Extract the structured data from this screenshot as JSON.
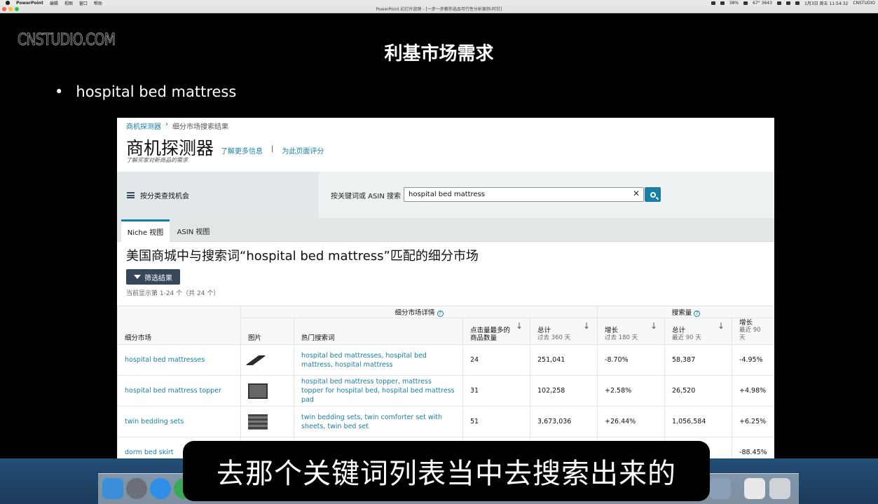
{
  "menubar": {
    "app": "PowerPoint",
    "items": [
      "编辑",
      "视图",
      "窗口",
      "帮助"
    ],
    "status": [
      "38%",
      "67° 3643",
      "1月3日 周五 11:54:32",
      "CNSTUDIO"
    ]
  },
  "window_title": "PowerPoint 幻灯片放映 - [一步一步教你选品可行性分析案例-阿甘]",
  "watermark": "CNSTUDIO.COM",
  "slide": {
    "title": "利基市场需求",
    "bullet_mark": "•",
    "bullet": "hospital bed mattress"
  },
  "tool": {
    "breadcrumb": {
      "root": "商机探测器",
      "sep": "›",
      "current": "细分市场搜索结果"
    },
    "title": "商机探测器",
    "link_more": "了解更多信息",
    "divider": "|",
    "link_rate": "为此页面评分",
    "subtitle": "了解买家对新商品的需求",
    "category_label": "按分类查找机会",
    "keyword_label": "按关键词或 ASIN 搜索",
    "keyword_value": "hospital bed mattress",
    "clear_glyph": "✕",
    "tabs": [
      "Niche 视图",
      "ASIN 视图"
    ],
    "results_heading": "美国商城中与搜索词“hospital bed mattress”匹配的细分市场",
    "filter_label": "筛选结果",
    "count_text": "当前显示第 1-24 个（共 24 个）",
    "table": {
      "group_details": "细分市场详情",
      "group_search": "搜索量",
      "qmark": "?",
      "col_niche": "细分市场",
      "col_image": "图片",
      "col_terms": "热门搜索词",
      "col_clicks": "点击量最多的商品数量",
      "col_total360": "总计",
      "col_total360_sub": "过去 360 天",
      "col_growth180": "增长",
      "col_growth180_sub": "过去 180 天",
      "col_total90": "总计",
      "col_total90_sub": "最近 90 天",
      "col_growth90": "增长",
      "col_growth90_sub": "最近 90 天",
      "sort_arrow": "↓",
      "rows": [
        {
          "niche": "hospital bed mattresses",
          "terms": "hospital bed mattresses, hospital bed mattress, hospital mattress",
          "clicks": "24",
          "total360": "251,041",
          "growth180": "-8.70%",
          "total90": "58,387",
          "growth90": "-4.95%"
        },
        {
          "niche": "hospital bed mattress topper",
          "terms": "hospital bed mattress topper, mattress topper for hospital bed, hospital bed mattress pad",
          "clicks": "31",
          "total360": "102,258",
          "growth180": "+2.58%",
          "total90": "26,520",
          "growth90": "+4.98%"
        },
        {
          "niche": "twin bedding sets",
          "terms": "twin bedding sets, twin comforter set with sheets, twin bed set",
          "clicks": "51",
          "total360": "3,673,036",
          "growth180": "+26.44%",
          "total90": "1,056,584",
          "growth90": "+6.25%"
        },
        {
          "niche": "dorm bed skirt",
          "terms": "",
          "clicks": "",
          "total360": "",
          "growth180": "",
          "total90": "",
          "growth90": "-88.45%"
        }
      ]
    }
  },
  "caption": "去那个关键词列表当中去搜索出来的",
  "colors": {
    "accent": "#1a7fa3",
    "dark_button": "#37475a"
  }
}
